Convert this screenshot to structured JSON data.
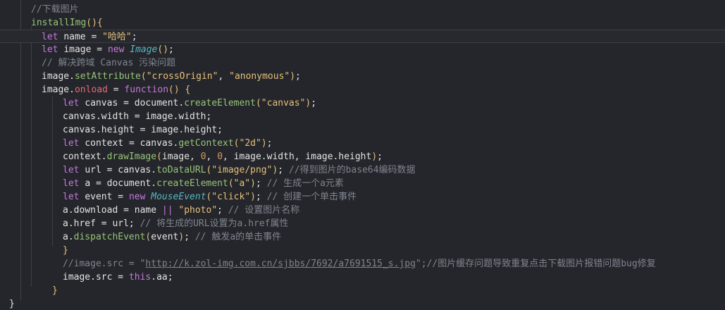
{
  "editor": {
    "lines": [
      {
        "indent": 44,
        "tokens": [
          {
            "t": "cmt",
            "v": "//下载图片"
          }
        ]
      },
      {
        "indent": 44,
        "tokens": [
          {
            "t": "fn",
            "v": "installImg"
          },
          {
            "t": "brace",
            "v": "(){"
          }
        ]
      },
      {
        "indent": 59,
        "current": true,
        "tokens": [
          {
            "t": "kw",
            "v": "let "
          },
          {
            "t": "plain",
            "v": "name "
          },
          {
            "t": "punc",
            "v": "= "
          },
          {
            "t": "str",
            "v": "\"哈哈\""
          },
          {
            "t": "punc",
            "v": ";"
          }
        ]
      },
      {
        "indent": 59,
        "tokens": [
          {
            "t": "kw",
            "v": "let "
          },
          {
            "t": "plain",
            "v": "image "
          },
          {
            "t": "punc",
            "v": "= "
          },
          {
            "t": "kw",
            "v": "new "
          },
          {
            "t": "cls",
            "v": "Image"
          },
          {
            "t": "brace",
            "v": "()"
          },
          {
            "t": "punc",
            "v": ";"
          }
        ]
      },
      {
        "indent": 59,
        "tokens": [
          {
            "t": "cmt",
            "v": "// 解决跨域 Canvas 污染问题"
          }
        ]
      },
      {
        "indent": 59,
        "tokens": [
          {
            "t": "plain",
            "v": "image."
          },
          {
            "t": "fn",
            "v": "setAttribute"
          },
          {
            "t": "brace",
            "v": "("
          },
          {
            "t": "str",
            "v": "\"crossOrigin\""
          },
          {
            "t": "punc",
            "v": ", "
          },
          {
            "t": "str",
            "v": "\"anonymous\""
          },
          {
            "t": "brace",
            "v": ")"
          },
          {
            "t": "punc",
            "v": ";"
          }
        ]
      },
      {
        "indent": 59,
        "tokens": [
          {
            "t": "plain",
            "v": "image."
          },
          {
            "t": "prop",
            "v": "onload "
          },
          {
            "t": "punc",
            "v": "= "
          },
          {
            "t": "kw",
            "v": "function"
          },
          {
            "t": "brace",
            "v": "() {"
          }
        ]
      },
      {
        "indent": 89,
        "tokens": [
          {
            "t": "kw",
            "v": "let "
          },
          {
            "t": "plain",
            "v": "canvas "
          },
          {
            "t": "punc",
            "v": "= "
          },
          {
            "t": "plain",
            "v": "document."
          },
          {
            "t": "fn",
            "v": "createElement"
          },
          {
            "t": "brace",
            "v": "("
          },
          {
            "t": "str",
            "v": "\"canvas\""
          },
          {
            "t": "brace",
            "v": ")"
          },
          {
            "t": "punc",
            "v": ";"
          }
        ]
      },
      {
        "indent": 89,
        "tokens": [
          {
            "t": "plain",
            "v": "canvas.width "
          },
          {
            "t": "punc",
            "v": "= "
          },
          {
            "t": "plain",
            "v": "image.width;"
          }
        ]
      },
      {
        "indent": 89,
        "tokens": [
          {
            "t": "plain",
            "v": "canvas.height "
          },
          {
            "t": "punc",
            "v": "= "
          },
          {
            "t": "plain",
            "v": "image.height;"
          }
        ]
      },
      {
        "indent": 89,
        "tokens": [
          {
            "t": "kw",
            "v": "let "
          },
          {
            "t": "plain",
            "v": "context "
          },
          {
            "t": "punc",
            "v": "= "
          },
          {
            "t": "plain",
            "v": "canvas."
          },
          {
            "t": "fn",
            "v": "getContext"
          },
          {
            "t": "brace",
            "v": "("
          },
          {
            "t": "str",
            "v": "\"2d\""
          },
          {
            "t": "brace",
            "v": ")"
          },
          {
            "t": "punc",
            "v": ";"
          }
        ]
      },
      {
        "indent": 89,
        "tokens": [
          {
            "t": "plain",
            "v": "context."
          },
          {
            "t": "fn",
            "v": "drawImage"
          },
          {
            "t": "brace",
            "v": "("
          },
          {
            "t": "plain",
            "v": "image, "
          },
          {
            "t": "num",
            "v": "0"
          },
          {
            "t": "punc",
            "v": ", "
          },
          {
            "t": "num",
            "v": "0"
          },
          {
            "t": "punc",
            "v": ", "
          },
          {
            "t": "plain",
            "v": "image.width, image.height"
          },
          {
            "t": "brace",
            "v": ")"
          },
          {
            "t": "punc",
            "v": ";"
          }
        ]
      },
      {
        "indent": 89,
        "tokens": [
          {
            "t": "kw",
            "v": "let "
          },
          {
            "t": "plain",
            "v": "url "
          },
          {
            "t": "punc",
            "v": "= "
          },
          {
            "t": "plain",
            "v": "canvas."
          },
          {
            "t": "fn",
            "v": "toDataURL"
          },
          {
            "t": "brace",
            "v": "("
          },
          {
            "t": "str",
            "v": "\"image/png\""
          },
          {
            "t": "brace",
            "v": ")"
          },
          {
            "t": "punc",
            "v": "; "
          },
          {
            "t": "cmt",
            "v": "//得到图片的base64编码数据"
          }
        ]
      },
      {
        "indent": 89,
        "tokens": [
          {
            "t": "kw",
            "v": "let "
          },
          {
            "t": "plain",
            "v": "a "
          },
          {
            "t": "punc",
            "v": "= "
          },
          {
            "t": "plain",
            "v": "document."
          },
          {
            "t": "fn",
            "v": "createElement"
          },
          {
            "t": "brace",
            "v": "("
          },
          {
            "t": "str",
            "v": "\"a\""
          },
          {
            "t": "brace",
            "v": ")"
          },
          {
            "t": "punc",
            "v": "; "
          },
          {
            "t": "cmt",
            "v": "// 生成一个a元素"
          }
        ]
      },
      {
        "indent": 89,
        "tokens": [
          {
            "t": "kw",
            "v": "let "
          },
          {
            "t": "plain",
            "v": "event "
          },
          {
            "t": "punc",
            "v": "= "
          },
          {
            "t": "kw",
            "v": "new "
          },
          {
            "t": "cls",
            "v": "MouseEvent"
          },
          {
            "t": "brace",
            "v": "("
          },
          {
            "t": "str",
            "v": "\"click\""
          },
          {
            "t": "brace",
            "v": ")"
          },
          {
            "t": "punc",
            "v": "; "
          },
          {
            "t": "cmt",
            "v": "// 创建一个单击事件"
          }
        ]
      },
      {
        "indent": 89,
        "tokens": [
          {
            "t": "plain",
            "v": "a.download "
          },
          {
            "t": "punc",
            "v": "= "
          },
          {
            "t": "plain",
            "v": "name "
          },
          {
            "t": "kw",
            "v": "|| "
          },
          {
            "t": "str",
            "v": "\"photo\""
          },
          {
            "t": "punc",
            "v": "; "
          },
          {
            "t": "cmt",
            "v": "// 设置图片名称"
          }
        ]
      },
      {
        "indent": 89,
        "tokens": [
          {
            "t": "plain",
            "v": "a.href "
          },
          {
            "t": "punc",
            "v": "= "
          },
          {
            "t": "plain",
            "v": "url; "
          },
          {
            "t": "cmt",
            "v": "// 将生成的URL设置为a.href属性"
          }
        ]
      },
      {
        "indent": 89,
        "tokens": [
          {
            "t": "plain",
            "v": "a."
          },
          {
            "t": "fn",
            "v": "dispatchEvent"
          },
          {
            "t": "brace",
            "v": "("
          },
          {
            "t": "plain",
            "v": "event"
          },
          {
            "t": "brace",
            "v": ")"
          },
          {
            "t": "punc",
            "v": "; "
          },
          {
            "t": "cmt",
            "v": "// 触发a的单击事件"
          }
        ]
      },
      {
        "indent": 89,
        "tokens": [
          {
            "t": "brace",
            "v": "}"
          }
        ]
      },
      {
        "indent": 89,
        "tokens": [
          {
            "t": "cmt",
            "v": "//image.src = \""
          },
          {
            "t": "cmts",
            "v": "http://k.zol-img.com.cn/sjbbs/7692/a7691515_s.jpg"
          },
          {
            "t": "cmt",
            "v": "\";//图片缓存问题导致重复点击下载图片报错问题bug修复"
          }
        ]
      },
      {
        "indent": 89,
        "tokens": [
          {
            "t": "plain",
            "v": "image.src "
          },
          {
            "t": "punc",
            "v": "= "
          },
          {
            "t": "kw",
            "v": "this"
          },
          {
            "t": "plain",
            "v": ".aa;"
          }
        ]
      },
      {
        "indent": 74,
        "tokens": [
          {
            "t": "brace",
            "v": "}"
          }
        ]
      },
      {
        "indent": 13,
        "tokens": [
          {
            "t": "plain",
            "v": "}"
          }
        ]
      }
    ]
  }
}
